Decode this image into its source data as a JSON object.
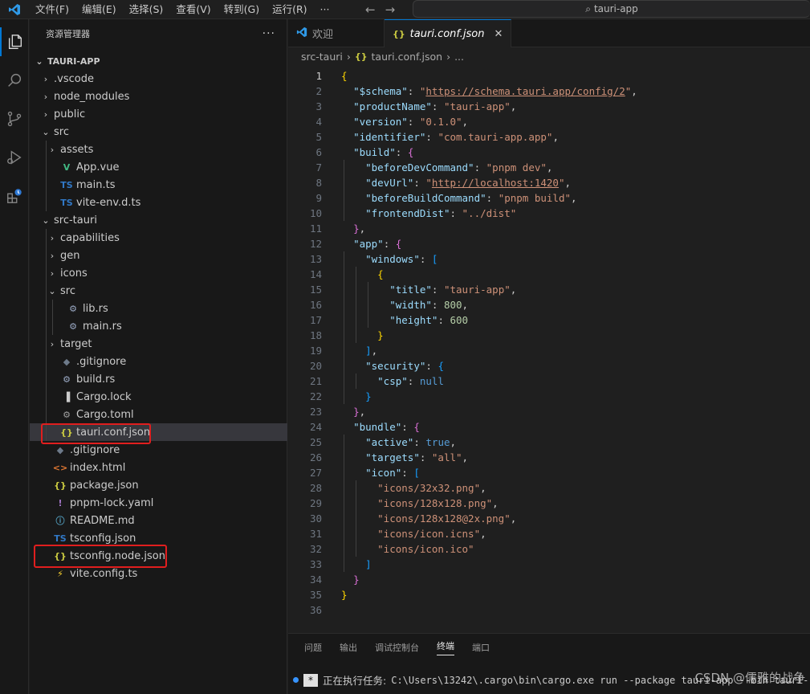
{
  "titlebar": {
    "menus": [
      "文件(F)",
      "编辑(E)",
      "选择(S)",
      "查看(V)",
      "转到(G)",
      "运行(R)"
    ],
    "more": "···",
    "search": "tauri-app",
    "back_glyph": "←",
    "forward_glyph": "→",
    "search_glyph": "⌕"
  },
  "sidebar": {
    "title": "资源管理器",
    "more": "···",
    "tree": [
      {
        "label": "TAURI-APP",
        "depth": 0,
        "chev": "⌄",
        "icon": "",
        "root": true
      },
      {
        "label": ".vscode",
        "depth": 1,
        "chev": "›",
        "icon": ""
      },
      {
        "label": "node_modules",
        "depth": 1,
        "chev": "›",
        "icon": ""
      },
      {
        "label": "public",
        "depth": 1,
        "chev": "›",
        "icon": ""
      },
      {
        "label": "src",
        "depth": 1,
        "chev": "⌄",
        "icon": ""
      },
      {
        "label": "assets",
        "depth": 2,
        "chev": "›",
        "icon": ""
      },
      {
        "label": "App.vue",
        "depth": 2,
        "chev": "",
        "icon": "V",
        "icolor": "#41b883"
      },
      {
        "label": "main.ts",
        "depth": 2,
        "chev": "",
        "icon": "TS",
        "icolor": "#3178c6"
      },
      {
        "label": "vite-env.d.ts",
        "depth": 2,
        "chev": "",
        "icon": "TS",
        "icolor": "#3178c6"
      },
      {
        "label": "src-tauri",
        "depth": 1,
        "chev": "⌄",
        "icon": ""
      },
      {
        "label": "capabilities",
        "depth": 2,
        "chev": "›",
        "icon": ""
      },
      {
        "label": "gen",
        "depth": 2,
        "chev": "›",
        "icon": ""
      },
      {
        "label": "icons",
        "depth": 2,
        "chev": "›",
        "icon": ""
      },
      {
        "label": "src",
        "depth": 2,
        "chev": "⌄",
        "icon": ""
      },
      {
        "label": "lib.rs",
        "depth": 3,
        "chev": "",
        "icon": "⚙",
        "icolor": "#9aa9c4"
      },
      {
        "label": "main.rs",
        "depth": 3,
        "chev": "",
        "icon": "⚙",
        "icolor": "#9aa9c4"
      },
      {
        "label": "target",
        "depth": 2,
        "chev": "›",
        "icon": ""
      },
      {
        "label": ".gitignore",
        "depth": 2,
        "chev": "",
        "icon": "◆",
        "icolor": "#6d7a8a"
      },
      {
        "label": "build.rs",
        "depth": 2,
        "chev": "",
        "icon": "⚙",
        "icolor": "#9aa9c4"
      },
      {
        "label": "Cargo.lock",
        "depth": 2,
        "chev": "",
        "icon": "▐",
        "icolor": "#cccccc"
      },
      {
        "label": "Cargo.toml",
        "depth": 2,
        "chev": "",
        "icon": "⚙",
        "icolor": "#a0a0a0"
      },
      {
        "label": "tauri.conf.json",
        "depth": 2,
        "chev": "",
        "icon": "{}",
        "icolor": "#cbcb41",
        "selected": true
      },
      {
        "label": ".gitignore",
        "depth": 1,
        "chev": "",
        "icon": "◆",
        "icolor": "#6d7a8a"
      },
      {
        "label": "index.html",
        "depth": 1,
        "chev": "",
        "icon": "<>",
        "icolor": "#e37933"
      },
      {
        "label": "package.json",
        "depth": 1,
        "chev": "",
        "icon": "{}",
        "icolor": "#cbcb41"
      },
      {
        "label": "pnpm-lock.yaml",
        "depth": 1,
        "chev": "",
        "icon": "!",
        "icolor": "#a074c4"
      },
      {
        "label": "README.md",
        "depth": 1,
        "chev": "",
        "icon": "ⓘ",
        "icolor": "#519aba"
      },
      {
        "label": "tsconfig.json",
        "depth": 1,
        "chev": "",
        "icon": "TS",
        "icolor": "#3178c6"
      },
      {
        "label": "tsconfig.node.json",
        "depth": 1,
        "chev": "",
        "icon": "{}",
        "icolor": "#cbcb41"
      },
      {
        "label": "vite.config.ts",
        "depth": 1,
        "chev": "",
        "icon": "⚡",
        "icolor": "#ffd62e"
      }
    ]
  },
  "editor": {
    "tabs": [
      {
        "label": "欢迎",
        "active": false
      },
      {
        "label": "tauri.conf.json",
        "active": true,
        "close": "✕"
      }
    ],
    "breadcrumb": [
      "src-tauri",
      "›",
      "{}",
      "tauri.conf.json",
      "›",
      "..."
    ],
    "current_line": 1,
    "lines": [
      "{",
      "  \"$schema\": \"https://schema.tauri.app/config/2\",",
      "  \"productName\": \"tauri-app\",",
      "  \"version\": \"0.1.0\",",
      "  \"identifier\": \"com.tauri-app.app\",",
      "  \"build\": {",
      "    \"beforeDevCommand\": \"pnpm dev\",",
      "    \"devUrl\": \"http://localhost:1420\",",
      "    \"beforeBuildCommand\": \"pnpm build\",",
      "    \"frontendDist\": \"../dist\"",
      "  },",
      "  \"app\": {",
      "    \"windows\": [",
      "      {",
      "        \"title\": \"tauri-app\",",
      "        \"width\": 800,",
      "        \"height\": 600",
      "      }",
      "    ],",
      "    \"security\": {",
      "      \"csp\": null",
      "    }",
      "  },",
      "  \"bundle\": {",
      "    \"active\": true,",
      "    \"targets\": \"all\",",
      "    \"icon\": [",
      "      \"icons/32x32.png\",",
      "      \"icons/128x128.png\",",
      "      \"icons/128x128@2x.png\",",
      "      \"icons/icon.icns\",",
      "      \"icons/icon.ico\"",
      "    ]",
      "  }",
      "}",
      ""
    ]
  },
  "panel": {
    "tabs": [
      "问题",
      "输出",
      "调试控制台",
      "终端",
      "端口"
    ],
    "active_tab": "终端",
    "terminal_star": "*",
    "terminal_label": "正在执行任务:",
    "terminal_cmd": "C:\\Users\\13242\\.cargo\\bin\\cargo.exe run --package tauri-app --bin tauri-",
    "watermark": "CSDN @儒雅的战争"
  },
  "colors": {
    "accent": "#0078d4",
    "highlight_box": "#e01e1e"
  }
}
